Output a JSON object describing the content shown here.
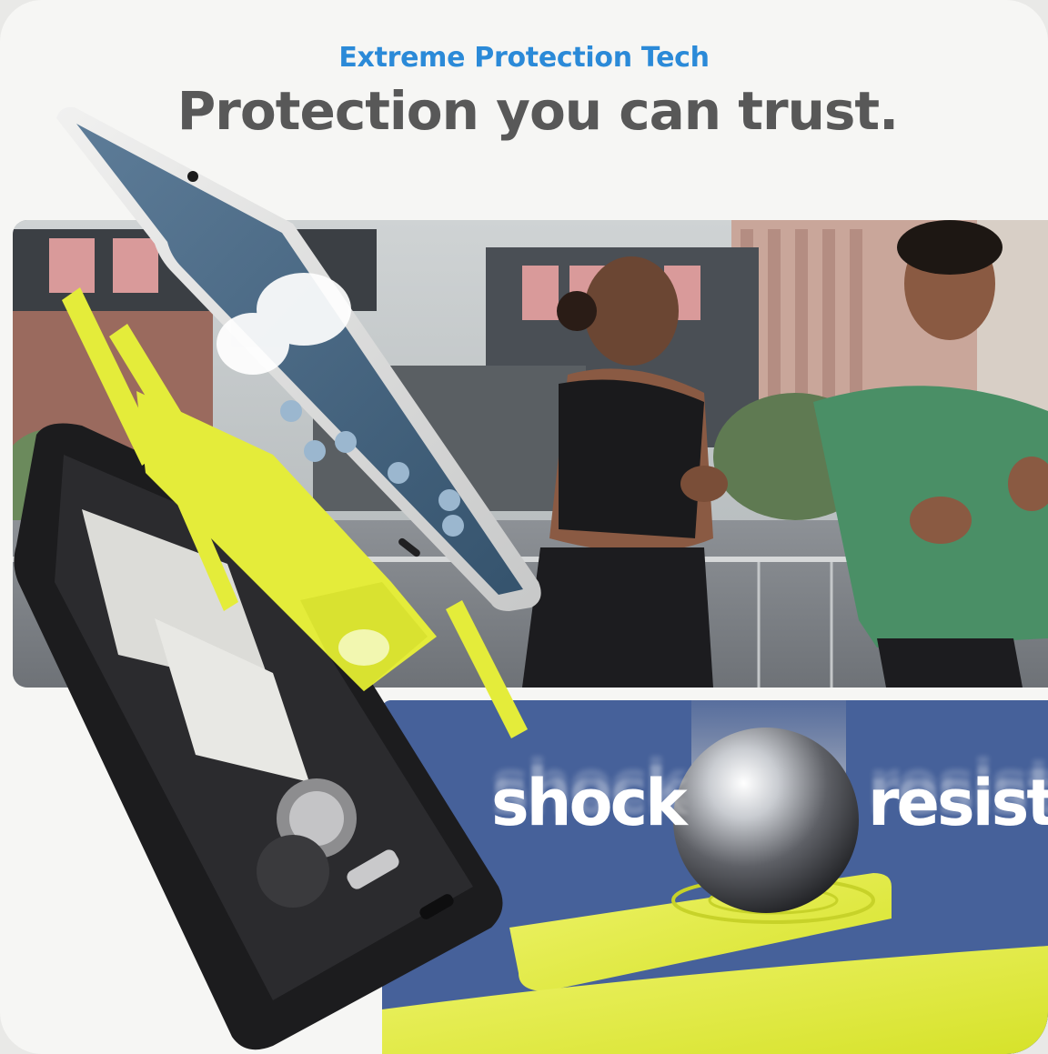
{
  "header": {
    "eyebrow": "Extreme Protection Tech",
    "headline": "Protection you can trust."
  },
  "impact_panel": {
    "word_left": "shock",
    "word_right": "resist"
  },
  "colors": {
    "eyebrow_blue": "#2b8ad8",
    "headline_gray": "#585858",
    "panel_blue": "#46619a",
    "accent_lime": "#e4ec3a",
    "case_black": "#1c1c1e"
  },
  "scene": {
    "photo": "two-runners-on-city-waterfront",
    "product": "exploded-rugged-phone-case",
    "impact": "steel-ball-dropping-on-cushion"
  }
}
